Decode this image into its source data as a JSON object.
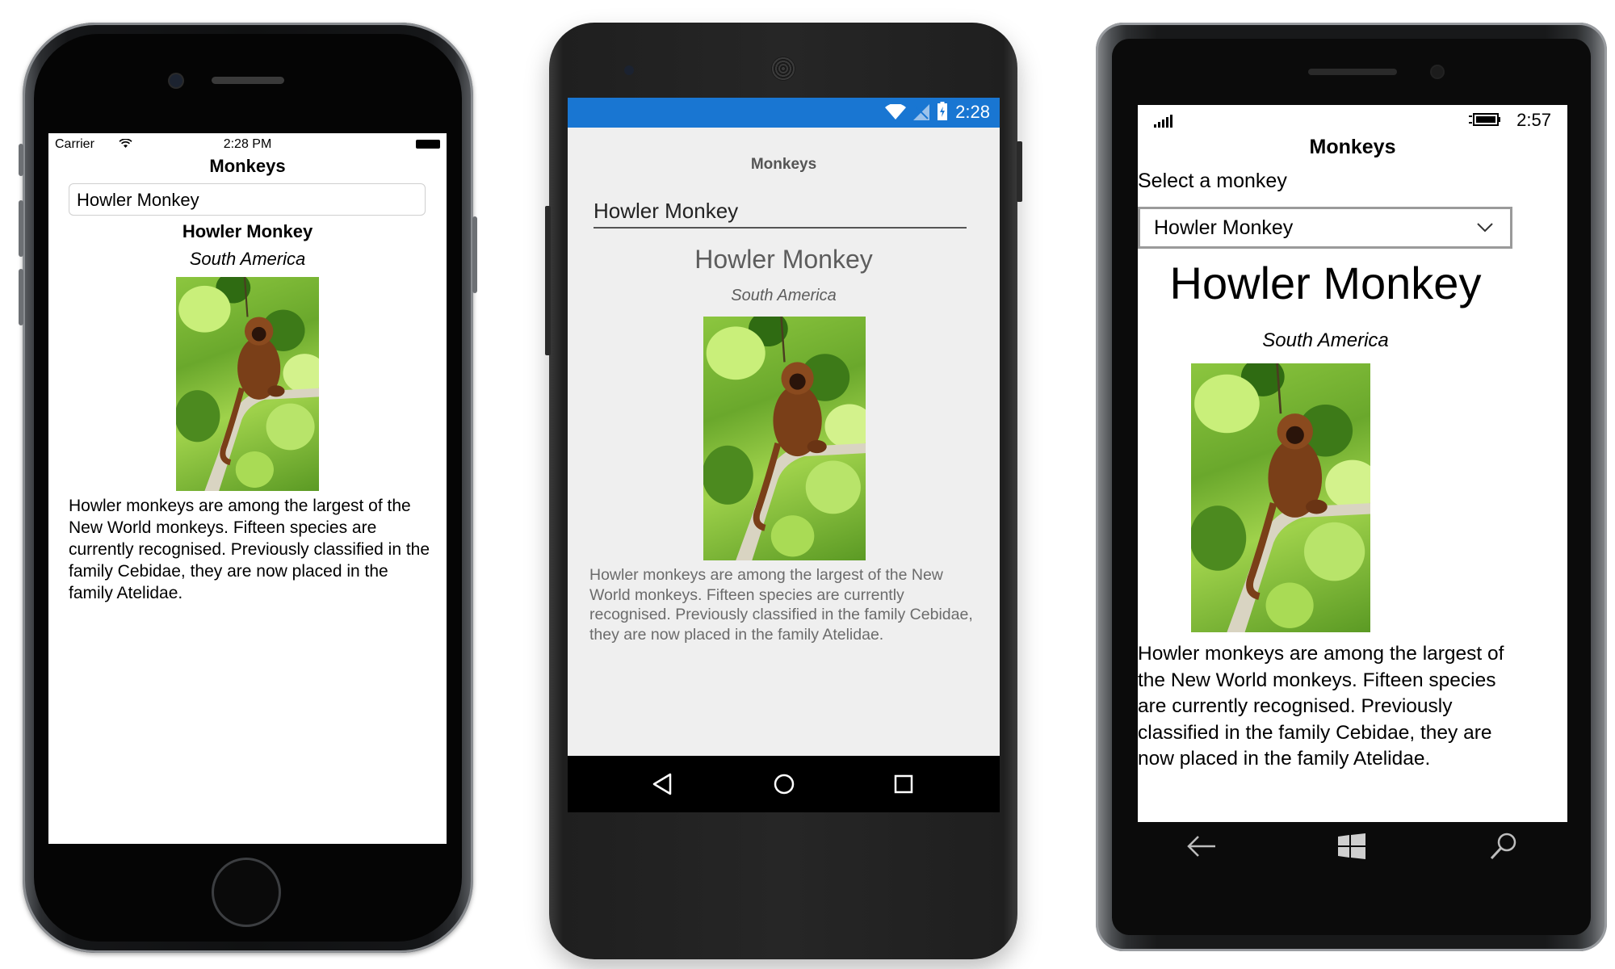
{
  "ios": {
    "status": {
      "carrier": "Carrier",
      "time": "2:28 PM"
    },
    "title": "Monkeys",
    "picker_value": "Howler Monkey",
    "monkey": {
      "name": "Howler Monkey",
      "location": "South America",
      "description": "Howler monkeys are among the largest of the New World monkeys. Fifteen species are currently recognised. Previously classified in the family Cebidae, they are now placed in the family Atelidae."
    }
  },
  "android": {
    "status": {
      "time": "2:28",
      "accent": "#1976d2"
    },
    "title": "Monkeys",
    "picker_value": "Howler Monkey",
    "monkey": {
      "name": "Howler Monkey",
      "location": "South America",
      "description": "Howler monkeys are among the largest of the New World monkeys. Fifteen species are currently recognised. Previously classified in the family Cebidae, they are now placed in the family Atelidae."
    },
    "nav_icons": [
      "back-icon",
      "home-icon",
      "recents-icon"
    ]
  },
  "windows": {
    "status": {
      "time": "2:57"
    },
    "title": "Monkeys",
    "picker_label": "Select a monkey",
    "picker_value": "Howler Monkey",
    "monkey": {
      "name": "Howler Monkey",
      "location": "South America",
      "description": "Howler monkeys are among the largest of the New World monkeys. Fifteen species are currently recognised. Previously classified in the family Cebidae, they are now placed in the family Atelidae."
    },
    "nav_icons": [
      "back-arrow-icon",
      "windows-logo-icon",
      "search-icon"
    ]
  }
}
